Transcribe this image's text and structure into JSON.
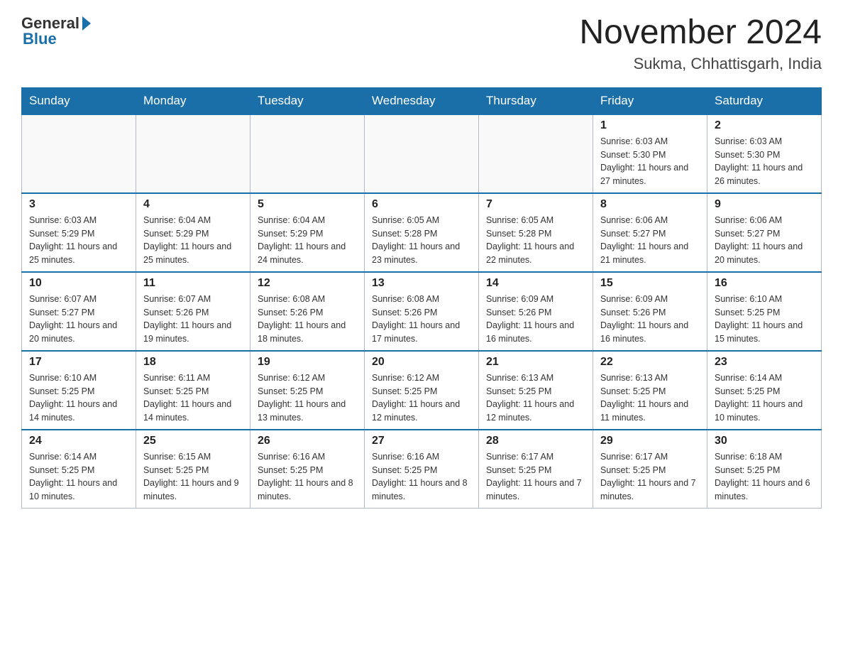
{
  "header": {
    "logo_text_general": "General",
    "logo_text_blue": "Blue",
    "month_title": "November 2024",
    "location": "Sukma, Chhattisgarh, India"
  },
  "days_of_week": [
    "Sunday",
    "Monday",
    "Tuesday",
    "Wednesday",
    "Thursday",
    "Friday",
    "Saturday"
  ],
  "weeks": [
    [
      {
        "day": "",
        "info": ""
      },
      {
        "day": "",
        "info": ""
      },
      {
        "day": "",
        "info": ""
      },
      {
        "day": "",
        "info": ""
      },
      {
        "day": "",
        "info": ""
      },
      {
        "day": "1",
        "info": "Sunrise: 6:03 AM\nSunset: 5:30 PM\nDaylight: 11 hours and 27 minutes."
      },
      {
        "day": "2",
        "info": "Sunrise: 6:03 AM\nSunset: 5:30 PM\nDaylight: 11 hours and 26 minutes."
      }
    ],
    [
      {
        "day": "3",
        "info": "Sunrise: 6:03 AM\nSunset: 5:29 PM\nDaylight: 11 hours and 25 minutes."
      },
      {
        "day": "4",
        "info": "Sunrise: 6:04 AM\nSunset: 5:29 PM\nDaylight: 11 hours and 25 minutes."
      },
      {
        "day": "5",
        "info": "Sunrise: 6:04 AM\nSunset: 5:29 PM\nDaylight: 11 hours and 24 minutes."
      },
      {
        "day": "6",
        "info": "Sunrise: 6:05 AM\nSunset: 5:28 PM\nDaylight: 11 hours and 23 minutes."
      },
      {
        "day": "7",
        "info": "Sunrise: 6:05 AM\nSunset: 5:28 PM\nDaylight: 11 hours and 22 minutes."
      },
      {
        "day": "8",
        "info": "Sunrise: 6:06 AM\nSunset: 5:27 PM\nDaylight: 11 hours and 21 minutes."
      },
      {
        "day": "9",
        "info": "Sunrise: 6:06 AM\nSunset: 5:27 PM\nDaylight: 11 hours and 20 minutes."
      }
    ],
    [
      {
        "day": "10",
        "info": "Sunrise: 6:07 AM\nSunset: 5:27 PM\nDaylight: 11 hours and 20 minutes."
      },
      {
        "day": "11",
        "info": "Sunrise: 6:07 AM\nSunset: 5:26 PM\nDaylight: 11 hours and 19 minutes."
      },
      {
        "day": "12",
        "info": "Sunrise: 6:08 AM\nSunset: 5:26 PM\nDaylight: 11 hours and 18 minutes."
      },
      {
        "day": "13",
        "info": "Sunrise: 6:08 AM\nSunset: 5:26 PM\nDaylight: 11 hours and 17 minutes."
      },
      {
        "day": "14",
        "info": "Sunrise: 6:09 AM\nSunset: 5:26 PM\nDaylight: 11 hours and 16 minutes."
      },
      {
        "day": "15",
        "info": "Sunrise: 6:09 AM\nSunset: 5:26 PM\nDaylight: 11 hours and 16 minutes."
      },
      {
        "day": "16",
        "info": "Sunrise: 6:10 AM\nSunset: 5:25 PM\nDaylight: 11 hours and 15 minutes."
      }
    ],
    [
      {
        "day": "17",
        "info": "Sunrise: 6:10 AM\nSunset: 5:25 PM\nDaylight: 11 hours and 14 minutes."
      },
      {
        "day": "18",
        "info": "Sunrise: 6:11 AM\nSunset: 5:25 PM\nDaylight: 11 hours and 14 minutes."
      },
      {
        "day": "19",
        "info": "Sunrise: 6:12 AM\nSunset: 5:25 PM\nDaylight: 11 hours and 13 minutes."
      },
      {
        "day": "20",
        "info": "Sunrise: 6:12 AM\nSunset: 5:25 PM\nDaylight: 11 hours and 12 minutes."
      },
      {
        "day": "21",
        "info": "Sunrise: 6:13 AM\nSunset: 5:25 PM\nDaylight: 11 hours and 12 minutes."
      },
      {
        "day": "22",
        "info": "Sunrise: 6:13 AM\nSunset: 5:25 PM\nDaylight: 11 hours and 11 minutes."
      },
      {
        "day": "23",
        "info": "Sunrise: 6:14 AM\nSunset: 5:25 PM\nDaylight: 11 hours and 10 minutes."
      }
    ],
    [
      {
        "day": "24",
        "info": "Sunrise: 6:14 AM\nSunset: 5:25 PM\nDaylight: 11 hours and 10 minutes."
      },
      {
        "day": "25",
        "info": "Sunrise: 6:15 AM\nSunset: 5:25 PM\nDaylight: 11 hours and 9 minutes."
      },
      {
        "day": "26",
        "info": "Sunrise: 6:16 AM\nSunset: 5:25 PM\nDaylight: 11 hours and 8 minutes."
      },
      {
        "day": "27",
        "info": "Sunrise: 6:16 AM\nSunset: 5:25 PM\nDaylight: 11 hours and 8 minutes."
      },
      {
        "day": "28",
        "info": "Sunrise: 6:17 AM\nSunset: 5:25 PM\nDaylight: 11 hours and 7 minutes."
      },
      {
        "day": "29",
        "info": "Sunrise: 6:17 AM\nSunset: 5:25 PM\nDaylight: 11 hours and 7 minutes."
      },
      {
        "day": "30",
        "info": "Sunrise: 6:18 AM\nSunset: 5:25 PM\nDaylight: 11 hours and 6 minutes."
      }
    ]
  ]
}
